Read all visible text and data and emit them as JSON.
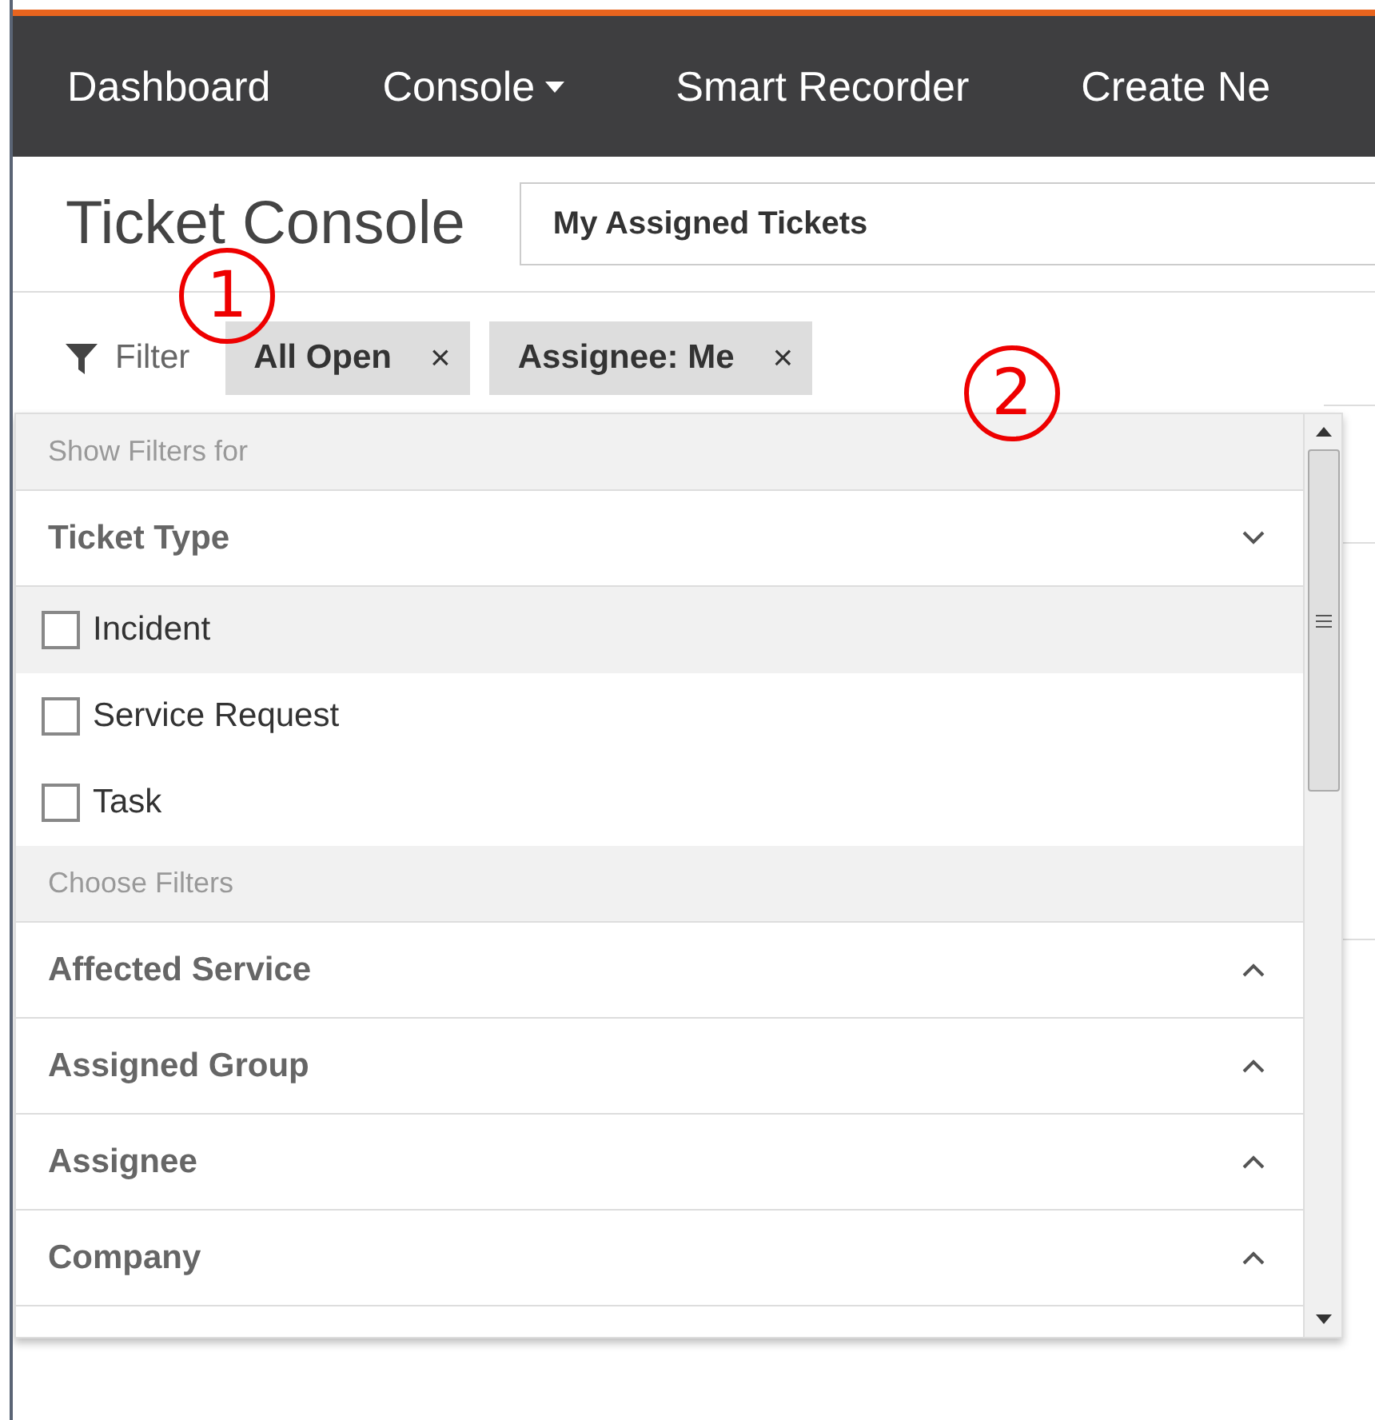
{
  "nav": {
    "items": [
      {
        "label": "Dashboard",
        "dropdown": false
      },
      {
        "label": "Console",
        "dropdown": true
      },
      {
        "label": "Smart Recorder",
        "dropdown": false
      },
      {
        "label": "Create Ne",
        "dropdown": false
      }
    ]
  },
  "page_title": "Ticket Console",
  "view_select": {
    "value": "My Assigned Tickets"
  },
  "filter_bar": {
    "label": "Filter",
    "chips": [
      {
        "label": "All Open",
        "remove": "×"
      },
      {
        "label": "Assignee: Me",
        "remove": "×"
      }
    ]
  },
  "filter_panel": {
    "sections": [
      {
        "kind": "header",
        "label": "Show Filters for"
      },
      {
        "kind": "group",
        "label": "Ticket Type",
        "expanded": true
      },
      {
        "kind": "option",
        "label": "Incident",
        "checked": false,
        "highlighted": true
      },
      {
        "kind": "option",
        "label": "Service Request",
        "checked": false,
        "highlighted": false
      },
      {
        "kind": "option",
        "label": "Task",
        "checked": false,
        "highlighted": false
      },
      {
        "kind": "header",
        "label": "Choose Filters"
      },
      {
        "kind": "group",
        "label": "Affected Service",
        "expanded": false
      },
      {
        "kind": "group",
        "label": "Assigned Group",
        "expanded": false
      },
      {
        "kind": "group",
        "label": "Assignee",
        "expanded": false
      },
      {
        "kind": "group",
        "label": "Company",
        "expanded": false
      }
    ]
  },
  "annotations": [
    "1",
    "2"
  ]
}
